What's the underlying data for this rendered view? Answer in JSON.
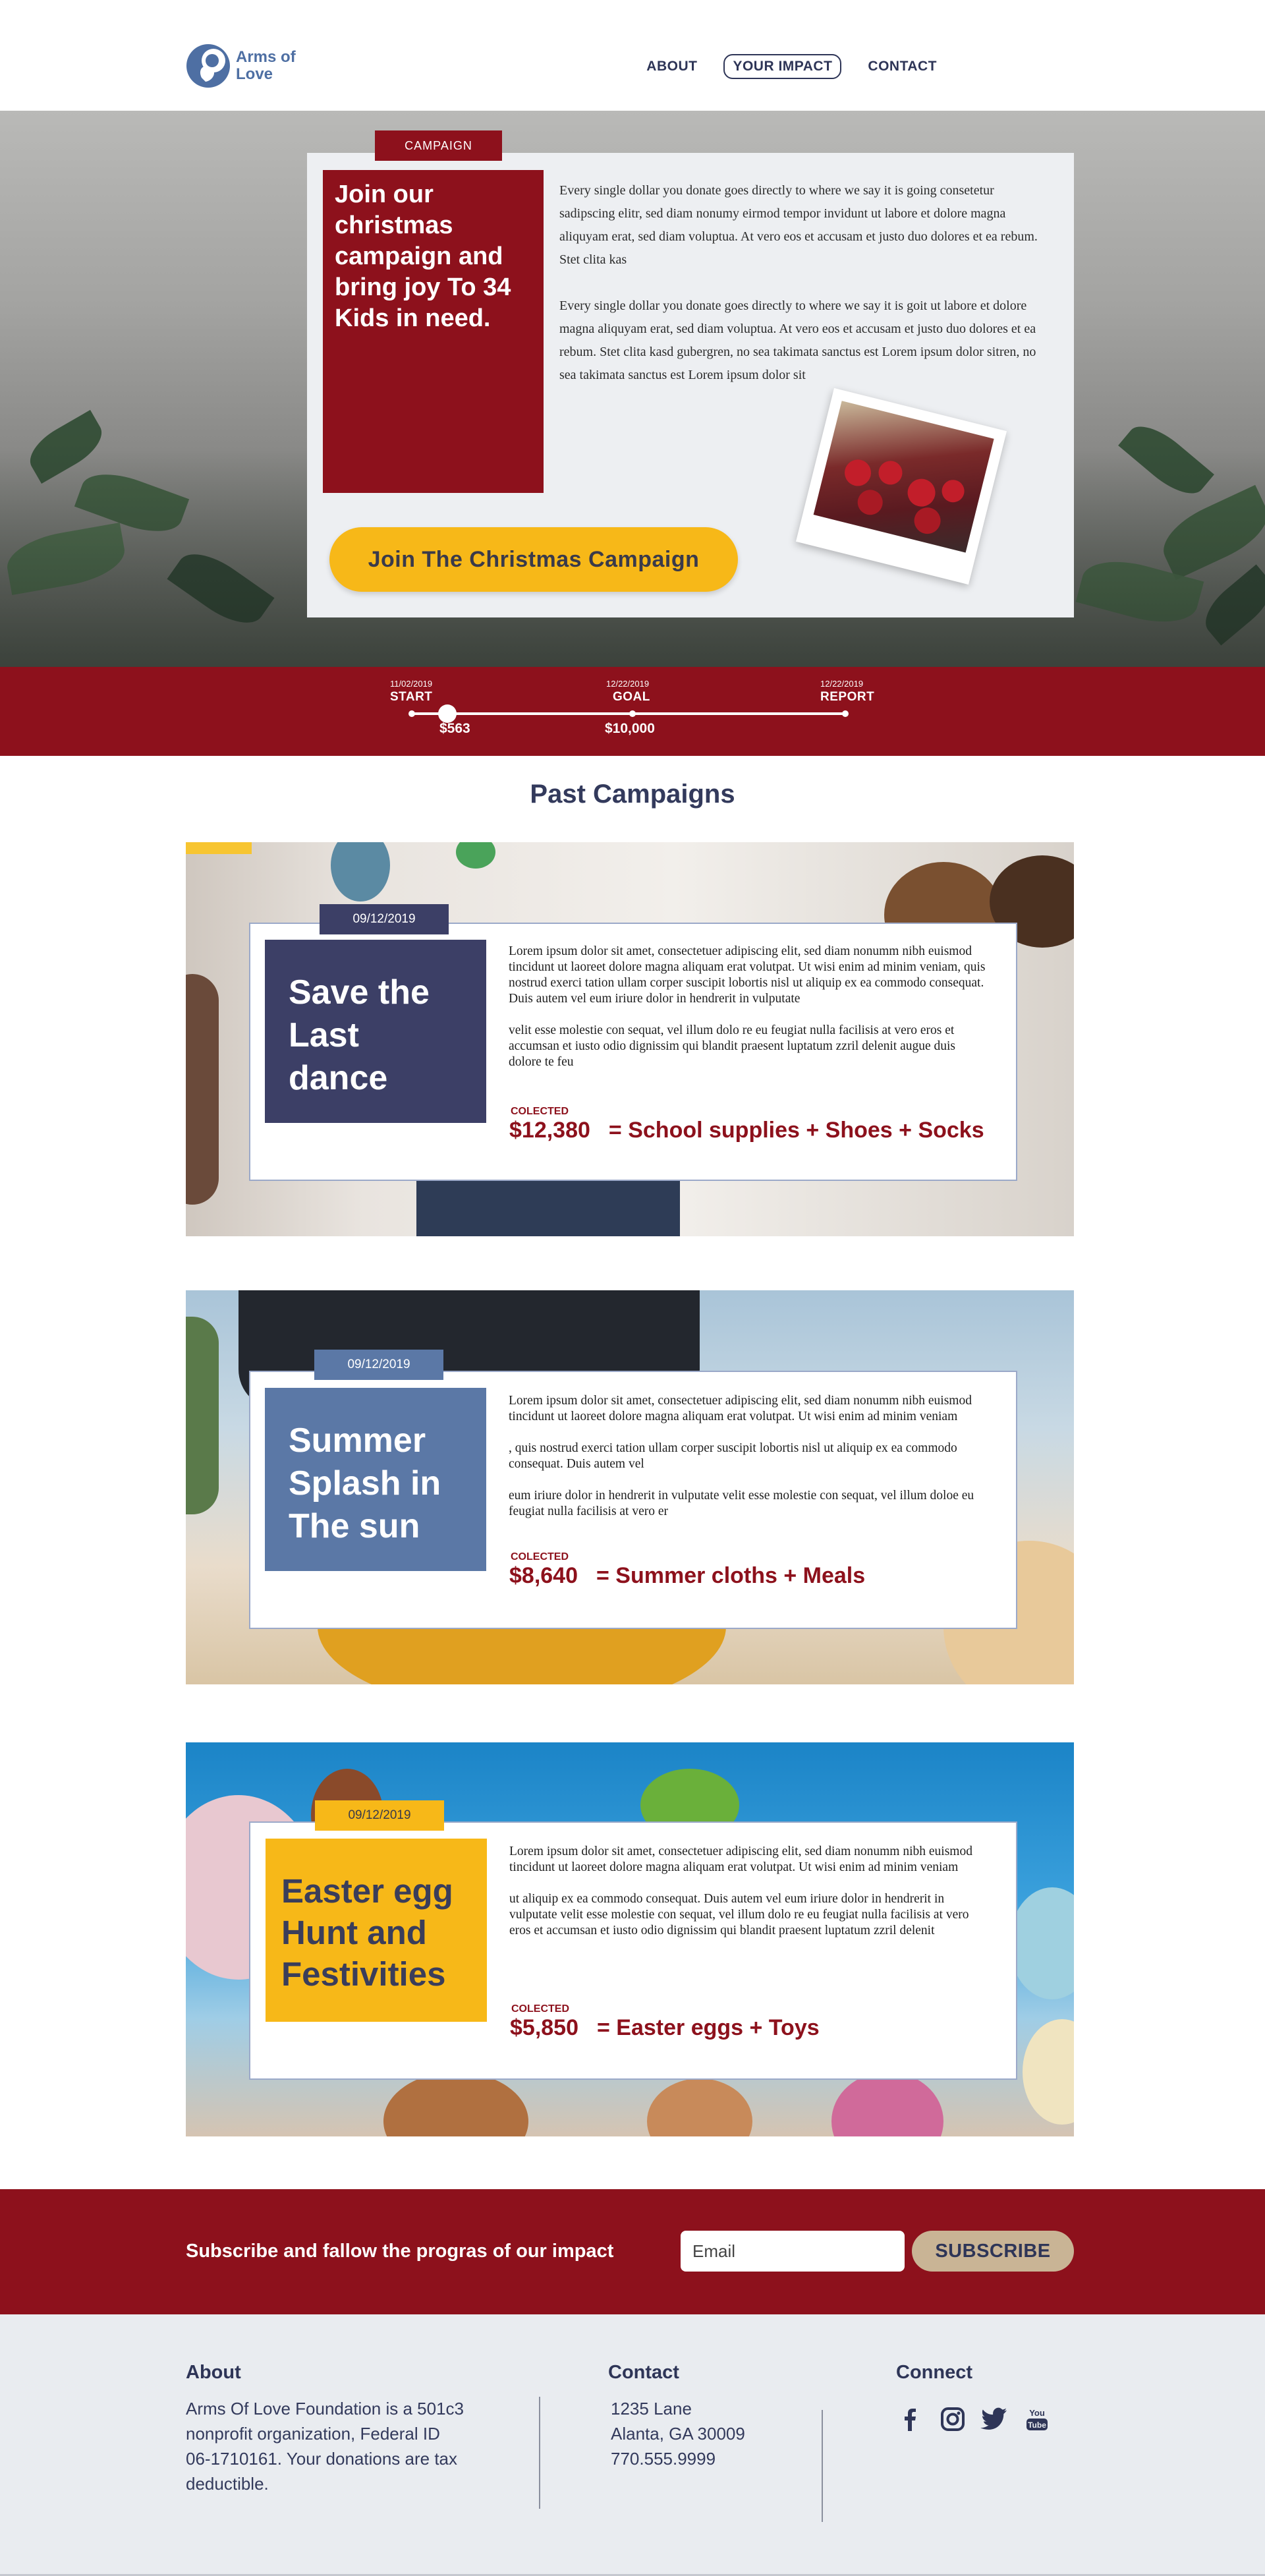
{
  "header": {
    "logo_text": "Arms of Love",
    "nav": [
      {
        "label": "ABOUT",
        "active": false
      },
      {
        "label": "YOUR IMPACT",
        "active": true
      },
      {
        "label": "CONTACT",
        "active": false
      }
    ]
  },
  "hero": {
    "tag": "CAMPAIGN",
    "title": "Join our christmas campaign and bring joy To 34 Kids in need.",
    "paragraph_1": "Every single dollar you donate goes directly to where we say it is going consetetur sadipscing elitr, sed diam nonumy eirmod tempor invidunt ut labore et dolore magna aliquyam erat, sed diam voluptua. At vero eos et accusam et justo duo dolores et ea rebum. Stet clita kas",
    "paragraph_2": "Every single dollar you donate goes directly to where we say it is goit ut labore et dolore magna aliquyam erat, sed diam voluptua. At vero eos et accusam et justo duo dolores et ea rebum. Stet clita kasd gubergren, no sea takimata sanctus est Lorem ipsum dolor sitren, no sea takimata sanctus est Lorem ipsum dolor sit",
    "cta_label": "Join The Christmas Campaign"
  },
  "progress": {
    "start": {
      "date": "11/02/2019",
      "label": "START"
    },
    "goal": {
      "date": "12/22/2019",
      "label": "GOAL",
      "amount": "$10,000"
    },
    "report": {
      "date": "12/22/2019",
      "label": "REPORT"
    },
    "raised": "$563",
    "raised_fraction": 0.0563
  },
  "past_campaigns": {
    "heading": "Past Campaigns",
    "items": [
      {
        "date": "09/12/2019",
        "title": "Save the Last dance",
        "color": "#3c3f66",
        "paragraph_1": "Lorem ipsum dolor sit amet, consectetuer adipiscing elit, sed diam nonumm nibh euismod tincidunt ut laoreet dolore magna aliquam erat volutpat. Ut wisi enim ad minim veniam, quis nostrud exerci tation ullam corper suscipit lobortis nisl ut aliquip ex ea commodo consequat. Duis autem vel eum iriure dolor in hendrerit in vulputate",
        "paragraph_2": "velit esse molestie con sequat, vel illum dolo re eu feugiat nulla facilisis at vero eros et accumsan et iusto odio dignissim qui blandit praesent luptatum zzril delenit augue duis dolore te feu",
        "collected_label": "COLECTED",
        "collected_amount": "$12,380",
        "collected_result": "= School supplies + Shoes + Socks"
      },
      {
        "date": "09/12/2019",
        "title": "Summer Splash in The sun",
        "color": "#5b78a6",
        "paragraph_1": "Lorem ipsum dolor sit amet, consectetuer adipiscing elit, sed diam nonumm nibh euismod tincidunt ut laoreet dolore magna aliquam erat volutpat. Ut wisi enim ad minim veniam",
        "paragraph_2": ", quis nostrud exerci tation ullam corper suscipit lobortis nisl ut aliquip ex ea commodo consequat. Duis autem vel",
        "paragraph_3": " eum iriure dolor in hendrerit in vulputate velit esse molestie con sequat, vel illum doloe eu feugiat nulla facilisis at vero er",
        "collected_label": "COLECTED",
        "collected_amount": "$8,640",
        "collected_result": "= Summer cloths + Meals"
      },
      {
        "date": "09/12/2019",
        "title": "Easter egg Hunt and Festivities",
        "color": "#f7b818",
        "paragraph_1": "Lorem ipsum dolor sit amet, consectetuer adipiscing elit, sed diam nonumm nibh euismod tincidunt ut laoreet dolore magna aliquam erat volutpat. Ut wisi enim ad minim veniam",
        "paragraph_2": "ut aliquip ex ea commodo consequat. Duis autem vel eum iriure dolor in hendrerit in vulputate velit esse molestie con sequat, vel illum dolo re eu feugiat nulla facilisis at vero eros et accumsan et iusto odio dignissim qui blandit praesent luptatum zzril delenit",
        "collected_label": "COLECTED",
        "collected_amount": "$5,850",
        "collected_result": "= Easter eggs + Toys"
      }
    ]
  },
  "subscribe": {
    "text": "Subscribe and fallow the progras of our impact",
    "email_placeholder": "Email",
    "button_label": "SUBSCRIBE"
  },
  "footer": {
    "about": {
      "heading": "About",
      "lines": [
        "Arms Of Love Foundation is a 501c3",
        "nonprofit organization, Federal ID",
        "06-1710161. Your donations are tax",
        "deductible."
      ]
    },
    "contact": {
      "heading": "Contact",
      "lines": [
        "1235 Lane",
        "Alanta, GA 30009",
        "770.555.9999"
      ]
    },
    "connect": {
      "heading": "Connect",
      "icons": [
        "facebook-icon",
        "instagram-icon",
        "twitter-icon",
        "youtube-icon"
      ]
    }
  },
  "colors": {
    "brand_red": "#8d111c",
    "navy": "#2e3557",
    "accent_yellow": "#f7b818",
    "logo_blue": "#4e6fa3"
  }
}
